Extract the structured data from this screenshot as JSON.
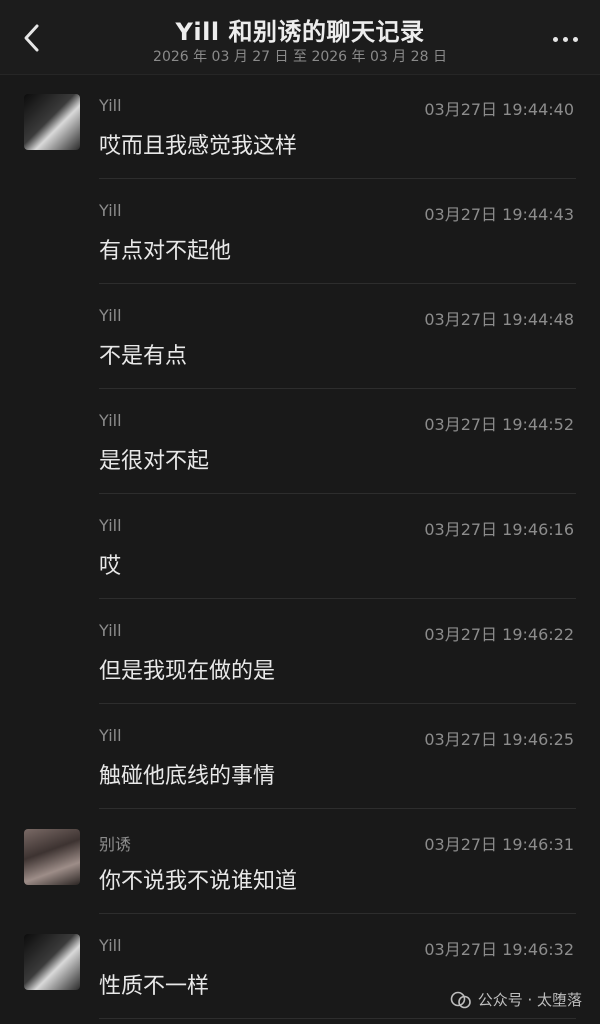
{
  "header": {
    "title": "Yill 和别诱的聊天记录",
    "date_range": "2026 年 03 月 27 日 至 2026 年 03 月 28 日",
    "icons": {
      "back": "chevron-left-icon",
      "more": "more-horizontal-icon"
    }
  },
  "messages": [
    {
      "sender": "Yill",
      "time": "03月27日 19:44:40",
      "text": "哎而且我感觉我这样",
      "show_avatar": true,
      "avatar": "yill"
    },
    {
      "sender": "Yill",
      "time": "03月27日 19:44:43",
      "text": "有点对不起他",
      "show_avatar": false
    },
    {
      "sender": "Yill",
      "time": "03月27日 19:44:48",
      "text": "不是有点",
      "show_avatar": false
    },
    {
      "sender": "Yill",
      "time": "03月27日 19:44:52",
      "text": "是很对不起",
      "show_avatar": false
    },
    {
      "sender": "Yill",
      "time": "03月27日 19:46:16",
      "text": "哎",
      "show_avatar": false
    },
    {
      "sender": "Yill",
      "time": "03月27日 19:46:22",
      "text": "但是我现在做的是",
      "show_avatar": false
    },
    {
      "sender": "Yill",
      "time": "03月27日 19:46:25",
      "text": "触碰他底线的事情",
      "show_avatar": false
    },
    {
      "sender": "别诱",
      "time": "03月27日 19:46:31",
      "text": "你不说我不说谁知道",
      "show_avatar": true,
      "avatar": "bieyou"
    },
    {
      "sender": "Yill",
      "time": "03月27日 19:46:32",
      "text": "性质不一样",
      "show_avatar": true,
      "avatar": "yill"
    }
  ],
  "watermark": {
    "text": "公众号 · 太堕落",
    "icon": "wechat-official-account-icon"
  }
}
